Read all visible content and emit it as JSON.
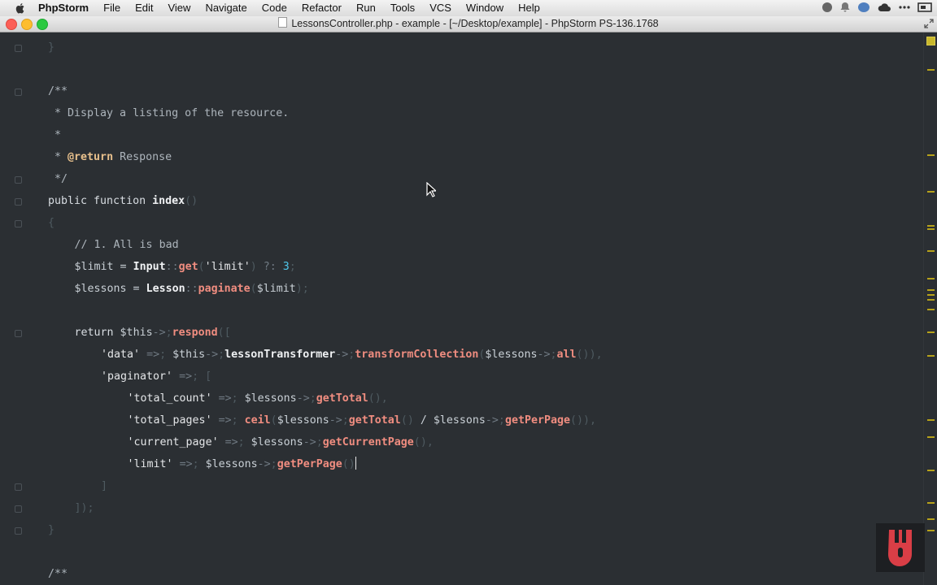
{
  "menubar": {
    "app_name": "PhpStorm",
    "items": [
      "File",
      "Edit",
      "View",
      "Navigate",
      "Code",
      "Refactor",
      "Run",
      "Tools",
      "VCS",
      "Window",
      "Help"
    ]
  },
  "window": {
    "title": "LessonsController.php - example - [~/Desktop/example] - PhpStorm PS-136.1768"
  },
  "code_lines": [
    {
      "t": "}",
      "k": "dim",
      "indent": 0
    },
    {
      "t": "",
      "k": "blank",
      "indent": 0
    },
    {
      "t": "/**",
      "k": "cm",
      "indent": 0
    },
    {
      "t": " * Display a listing of the resource.",
      "k": "cm",
      "indent": 0
    },
    {
      "t": " *",
      "k": "cm",
      "indent": 0
    },
    {
      "t": " * @return Response",
      "k": "doc-return",
      "indent": 0
    },
    {
      "t": " */",
      "k": "cm",
      "indent": 0
    },
    {
      "t": "public function index()",
      "k": "sig",
      "indent": 0
    },
    {
      "t": "{",
      "k": "dim",
      "indent": 0
    },
    {
      "t": "// 1. All is bad",
      "k": "cm",
      "indent": 1
    },
    {
      "t": "$limit = Input::get('limit') ?: 3;",
      "k": "limit",
      "indent": 1
    },
    {
      "t": "$lessons = Lesson::paginate($limit);",
      "k": "lessons",
      "indent": 1
    },
    {
      "t": "",
      "k": "blank",
      "indent": 0
    },
    {
      "t": "return $this->respond([",
      "k": "return",
      "indent": 1
    },
    {
      "t": "'data' => $this->lessonTransformer->transformCollection($lessons->all()),",
      "k": "data",
      "indent": 2
    },
    {
      "t": "'paginator' => [",
      "k": "paginator",
      "indent": 2
    },
    {
      "t": "'total_count' => $lessons->getTotal(),",
      "k": "total_count",
      "indent": 3
    },
    {
      "t": "'total_pages' => ceil($lessons->getTotal() / $lessons->getPerPage()),",
      "k": "total_pages",
      "indent": 3
    },
    {
      "t": "'current_page' => $lessons->getCurrentPage(),",
      "k": "current_page",
      "indent": 3
    },
    {
      "t": "'limit' => $lessons->getPerPage()",
      "k": "limitline",
      "indent": 3
    },
    {
      "t": "]",
      "k": "dim",
      "indent": 2
    },
    {
      "t": "]);",
      "k": "dim",
      "indent": 1
    },
    {
      "t": "}",
      "k": "dim",
      "indent": 0
    },
    {
      "t": "",
      "k": "blank",
      "indent": 0
    },
    {
      "t": "/**",
      "k": "cm",
      "indent": 0
    }
  ],
  "colors": {
    "editor_bg": "#2b2f33",
    "method": "#f08d80",
    "number": "#4fc8ec",
    "annotation": "#e8c08c",
    "marker": "#b7a21a"
  },
  "icons": [
    "apple-icon",
    "status-icons",
    "fullscreen-icon",
    "logo-icon",
    "mouse-cursor-icon"
  ]
}
